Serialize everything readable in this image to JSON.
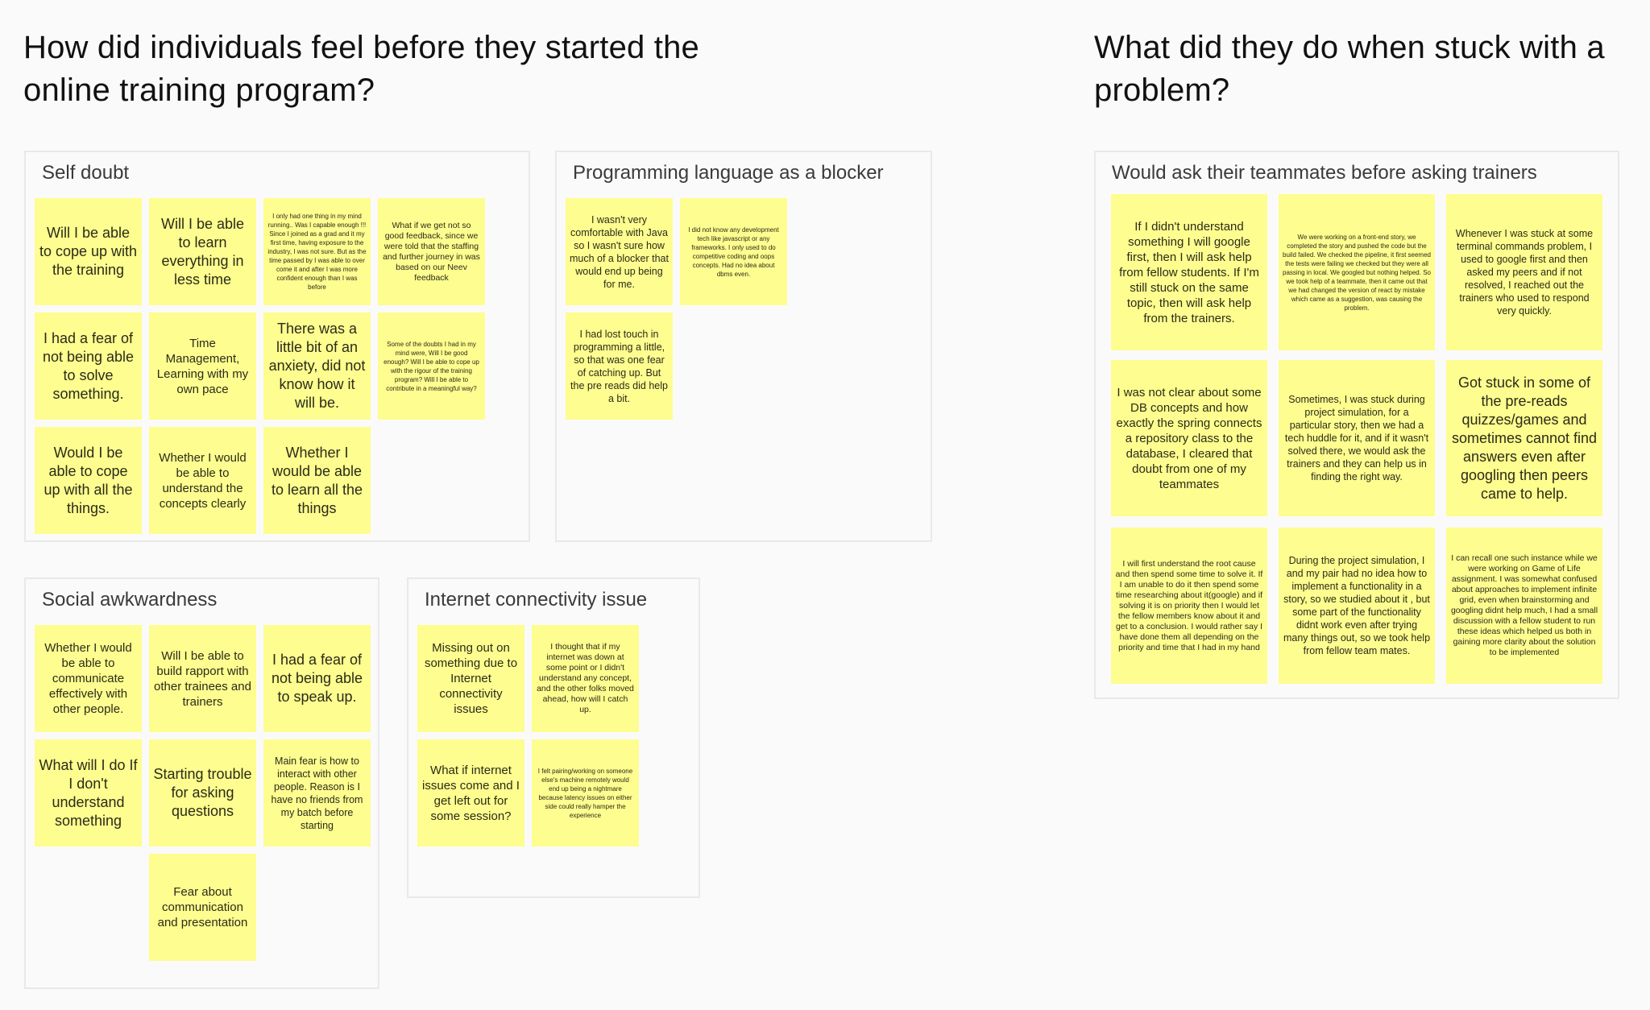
{
  "headings": {
    "left": "How did individuals feel before they started the online training program?",
    "right": "What did they do when stuck with a problem?"
  },
  "note_color": "#fefd8f",
  "panels": {
    "self_doubt": {
      "title": "Self doubt",
      "notes": [
        "Will I be able to cope up with the training",
        "Will I be able to learn everything in less time",
        "I only had one thing in my mind running.. Was I capable enough !!! Since I joined as a grad and it my first time, having exposure to the industry, I was not sure. But as the time passed by I was able to over come it and after I was more confident enough than I was before",
        "What if we get not so good feedback, since we were told that the staffing and further journey in was based on our Neev feedback",
        "I had a fear of not being able to solve something.",
        "Time Management, Learning with my own pace",
        "There was a little bit of an anxiety, did not know how it will be.",
        "Some of the doubts I had in my mind were, Will I be good enough? Will I be able to cope up with the rigour of the training program? Will I be able to contribute in a meaningful way?",
        "Would I be able to cope up with all the things.",
        "Whether I would be able to understand the concepts clearly",
        "Whether I would be able to learn all the things"
      ]
    },
    "programming": {
      "title": "Programming language as a blocker",
      "notes": [
        "I wasn't very comfortable with Java so I wasn't sure how much of a blocker that would end up being for me.",
        "I did not know any development tech like javascript or any frameworks. I only used to do competitive coding and oops concepts. Had no idea about dbms even.",
        "I had lost touch in programming a little, so that was one fear of catching up. But the pre reads did help a bit."
      ]
    },
    "social": {
      "title": "Social awkwardness",
      "notes": [
        "Whether I would be able to communicate effectively with other people.",
        "Will I be able to build rapport with other trainees and trainers",
        "I had a fear of not being able to speak up.",
        "What will I do If I don't understand something",
        "Starting trouble for asking questions",
        "Main fear is how to interact with other people. Reason is I have no friends from my batch before starting",
        "Fear about communication and presentation"
      ]
    },
    "internet": {
      "title": "Internet connectivity issue",
      "notes": [
        "Missing out on something due to Internet connectivity issues",
        "I thought that if my internet was down at some point or I didn't understand any concept, and the other folks moved ahead, how will I catch up.",
        "What if internet issues come and I get left out for some session?",
        "I felt pairing/working on someone else's machine remotely would end up being a nightmare because latency issues on either side could really hamper the experience"
      ]
    },
    "teammates": {
      "title": "Would ask their teammates before asking trainers",
      "notes": [
        "If I didn't understand something I will google first, then I will ask help from fellow students. If I'm still stuck on the same topic, then will ask help from the trainers.",
        "We were working on a front-end story, we completed the story and pushed the code but the build failed. We checked the pipeline, it first seemed the tests were failing we checked but they were all passing in local. We googled but nothing helped. So we took help of a teammate, then it came out that we had changed the version of react by mistake which came as a suggestion, was causing the problem.",
        "Whenever I was stuck at some terminal commands problem, I used to google first and then asked my peers and if not resolved, I reached out the trainers who used to respond very quickly.",
        "I was not clear about some DB concepts and how exactly the spring connects a repository class to the database, I cleared that doubt from one of my teammates",
        "Sometimes, I was stuck during project simulation, for a particular story, then we had a tech huddle for it, and if it wasn't solved there, we would ask the trainers and they can help us in finding the right way.",
        "Got stuck in some of the pre-reads quizzes/games and sometimes cannot find answers even after googling then peers came to help.",
        "I will first understand the root cause and then spend some time to solve it. If I am unable to do it then spend some time researching about it(google) and if solving it is on priority then I would let the fellow members know about it and get to a conclusion. I would rather say I have done them all depending on the priority and time that I had in my hand",
        "During the project simulation, I and my pair had no idea how to implement a functionality in a story, so we studied about it , but some part of the functionality didnt work even after trying many things out, so we took help from fellow team mates.",
        "I can recall one such instance while we were working on Game of Life assignment. I was somewhat confused about approaches to implement infinite grid, even when brainstorming and googling didnt help much, I had a small discussion with a fellow student to run these ideas which helped us both in gaining more clarity about the solution to be implemented"
      ]
    }
  }
}
